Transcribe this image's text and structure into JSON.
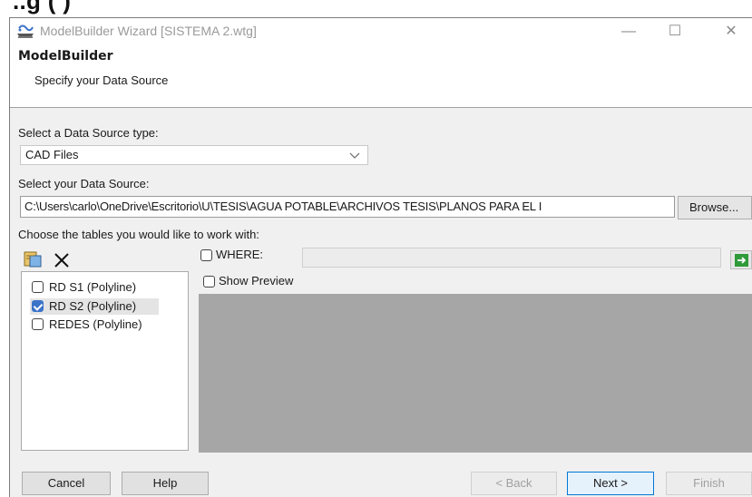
{
  "cutoff_text": "..g                                                          (                    )",
  "window": {
    "title": "ModelBuilder Wizard [SISTEMA 2.wtg]",
    "minimize_glyph": "—",
    "maximize_glyph": "☐",
    "close_glyph": "✕"
  },
  "header": {
    "title": "ModelBuilder",
    "subtitle": "Specify your Data Source"
  },
  "source_type": {
    "label": "Select a Data Source type:",
    "value": "CAD Files"
  },
  "data_source": {
    "label": "Select your Data Source:",
    "path": "C:\\Users\\carlo\\OneDrive\\Escritorio\\U\\TESIS\\AGUA POTABLE\\ARCHIVOS TESIS\\PLANOS PARA EL I",
    "browse_label": "Browse..."
  },
  "tables": {
    "label": "Choose the tables you would like to work with:",
    "items": [
      {
        "label": "RD S1 (Polyline)",
        "checked": false
      },
      {
        "label": "RD S2 (Polyline)",
        "checked": true
      },
      {
        "label": "REDES (Polyline)",
        "checked": false
      }
    ]
  },
  "where": {
    "label": "WHERE:",
    "checked": false
  },
  "show_preview": {
    "label": "Show Preview",
    "checked": false
  },
  "footer": {
    "cancel": "Cancel",
    "help": "Help",
    "back": "< Back",
    "next": "Next >",
    "finish": "Finish"
  },
  "colors": {
    "accent": "#0078d7",
    "check_blue": "#3b73c9",
    "preview_bg": "#a6a6a6",
    "go_arrow": "#2f9a3a"
  }
}
